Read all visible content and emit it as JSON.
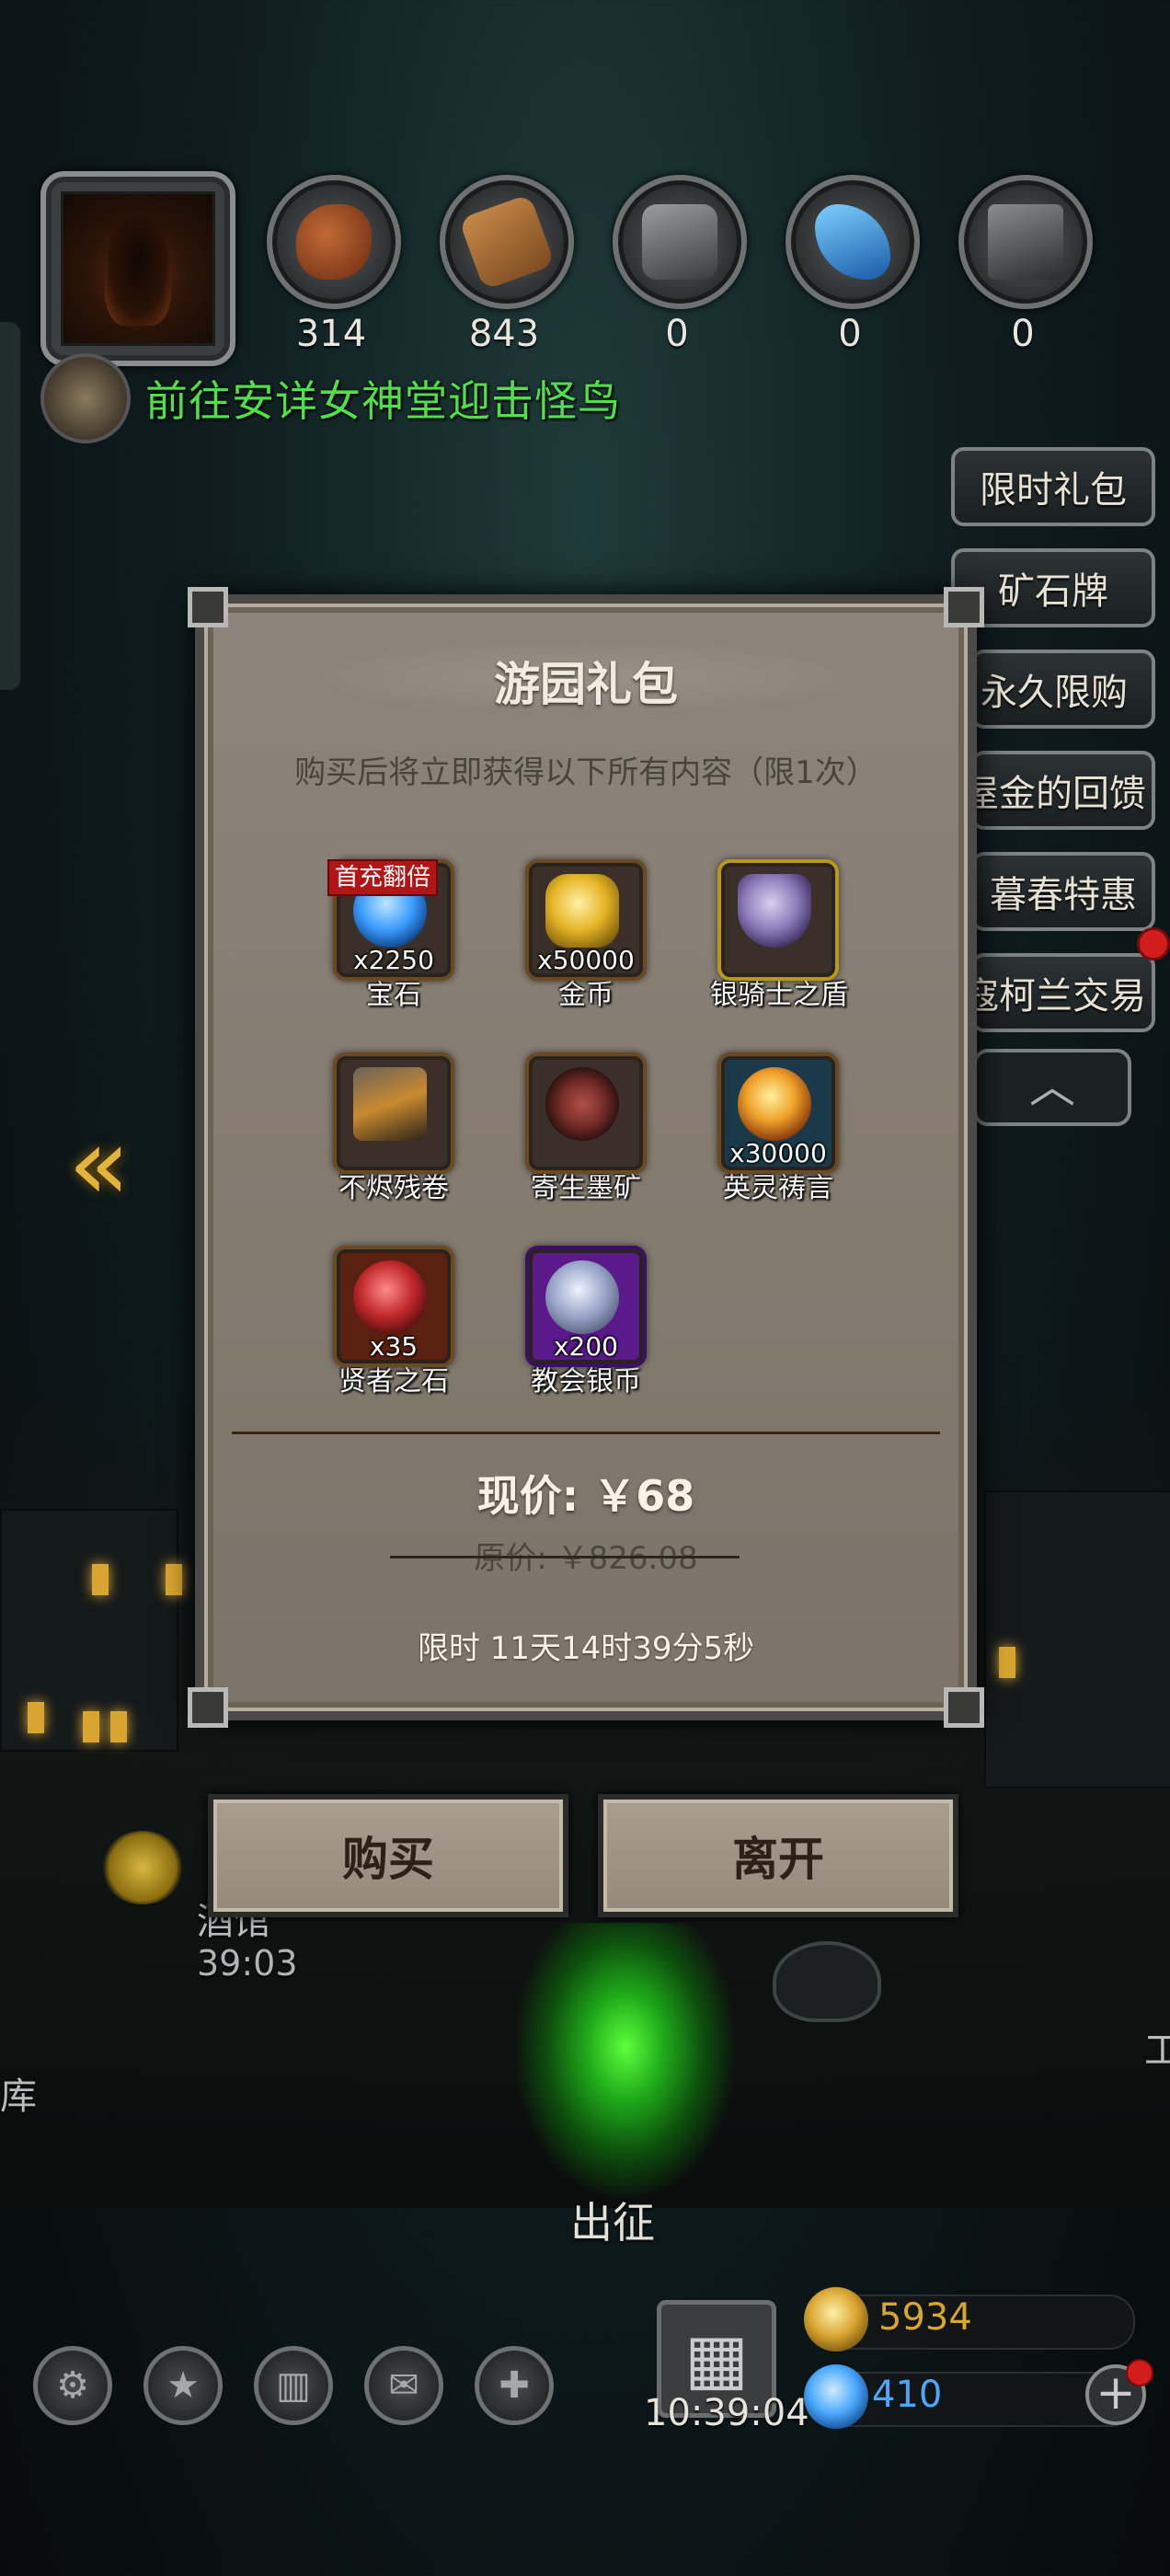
{
  "resources": [
    {
      "name": "meat-icon",
      "value": "314",
      "color": "#9a4a22"
    },
    {
      "name": "wood-icon",
      "value": "843",
      "color": "#a0703a"
    },
    {
      "name": "iron-icon",
      "value": "0",
      "color": "#6c6e70"
    },
    {
      "name": "crystal-icon",
      "value": "0",
      "color": "#2e8ad8"
    },
    {
      "name": "ore-icon",
      "value": "0",
      "color": "#56595b"
    }
  ],
  "quest": {
    "text": "前往安详女神堂迎击怪鸟"
  },
  "side_menu": [
    "限时礼包",
    "矿石牌",
    "永久限购",
    "屋金的回馈",
    "暮春特惠",
    "寇柯兰交易"
  ],
  "dialog": {
    "title": "游园礼包",
    "subtitle": "购买后将立即获得以下所有内容（限1次）",
    "badge": "首充翻倍",
    "items": [
      {
        "name": "宝石",
        "qty": "x2250",
        "icon": "gem-icon",
        "color": "#3a9cff"
      },
      {
        "name": "金币",
        "qty": "x50000",
        "icon": "gold-coin-icon",
        "color": "#e6b526"
      },
      {
        "name": "银骑士之盾",
        "qty": "",
        "icon": "shield-icon",
        "color": "#8c7ab8"
      },
      {
        "name": "不烬残卷",
        "qty": "",
        "icon": "scroll-icon",
        "color": "#c98a2e"
      },
      {
        "name": "寄生墨矿",
        "qty": "",
        "icon": "dark-ore-icon",
        "color": "#7a2e2a"
      },
      {
        "name": "英灵祷言",
        "qty": "x30000",
        "icon": "spirit-orb-icon",
        "color": "#f0a22a"
      },
      {
        "name": "贤者之石",
        "qty": "x35",
        "icon": "sage-stone-icon",
        "color": "#c0282a"
      },
      {
        "name": "教会银币",
        "qty": "x200",
        "icon": "silver-coin-icon",
        "color": "#9aa6c8"
      }
    ],
    "price_now": "现价: ￥68",
    "price_original": "原价: ￥826.08",
    "limit_time": "限时 11天14时39分5秒"
  },
  "buttons": {
    "buy": "购买",
    "leave": "离开"
  },
  "scene": {
    "tavern": "酒馆",
    "tavern_time": "39:03",
    "warehouse": "库",
    "expedition": "出征",
    "right_edge": "工"
  },
  "footer": {
    "clock": "10:39:04",
    "gold": "5934",
    "gems": "410",
    "gold_color": "#d9a531",
    "gem_color": "#4aa8ff"
  }
}
